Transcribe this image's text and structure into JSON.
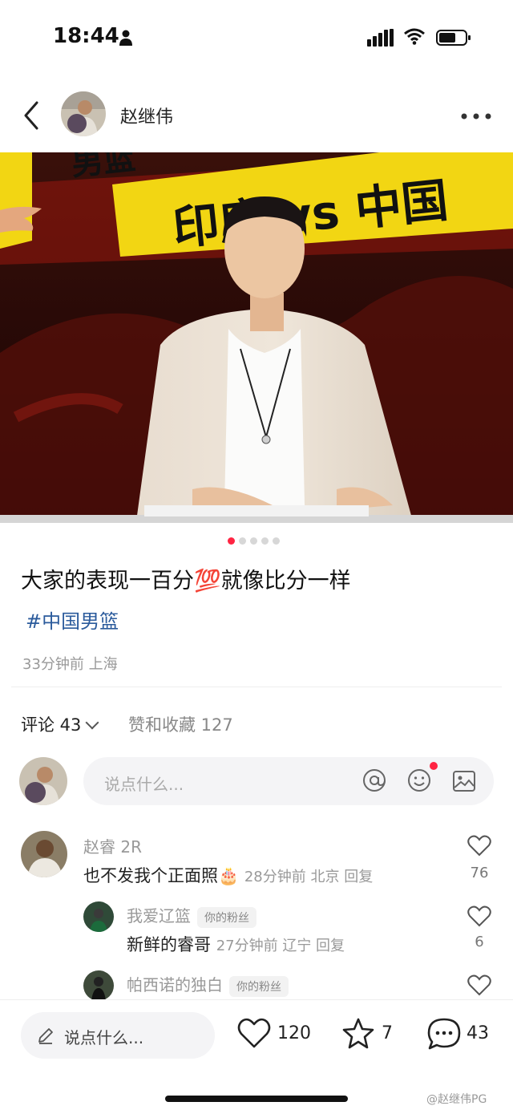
{
  "status_bar": {
    "time": "18:44"
  },
  "nav": {
    "username": "赵继伟"
  },
  "photo": {
    "banner_text": "印度 vs 中国",
    "banner_top_text": "男篮"
  },
  "carousel": {
    "count": 5,
    "active": 1
  },
  "post": {
    "text": "大家的表现一百分💯就像比分一样",
    "hashtag": "#中国男篮",
    "meta": "33分钟前 上海"
  },
  "tabs": {
    "comments": "评论 43",
    "likes": "赞和收藏 127"
  },
  "comment_input": {
    "placeholder": "说点什么..."
  },
  "comments": [
    {
      "name": "赵睿 2R",
      "text": "也不发我个正面照🎂",
      "meta": "28分钟前 北京 回复",
      "likes": "76"
    },
    {
      "name": "我爱辽篮",
      "badge": "你的粉丝",
      "text": "新鲜的睿哥",
      "meta": "27分钟前 辽宁 回复",
      "likes": "6"
    },
    {
      "name": "帕西诺的独白",
      "badge": "你的粉丝"
    }
  ],
  "bottom": {
    "placeholder": "说点什么...",
    "likes": "120",
    "favorites": "7",
    "comments": "43"
  },
  "watermark": "@赵继伟PG",
  "colors": {
    "hashtag": "#2b5b9c",
    "accent_red": "#ff2442",
    "banner_yellow": "#f2d613"
  }
}
